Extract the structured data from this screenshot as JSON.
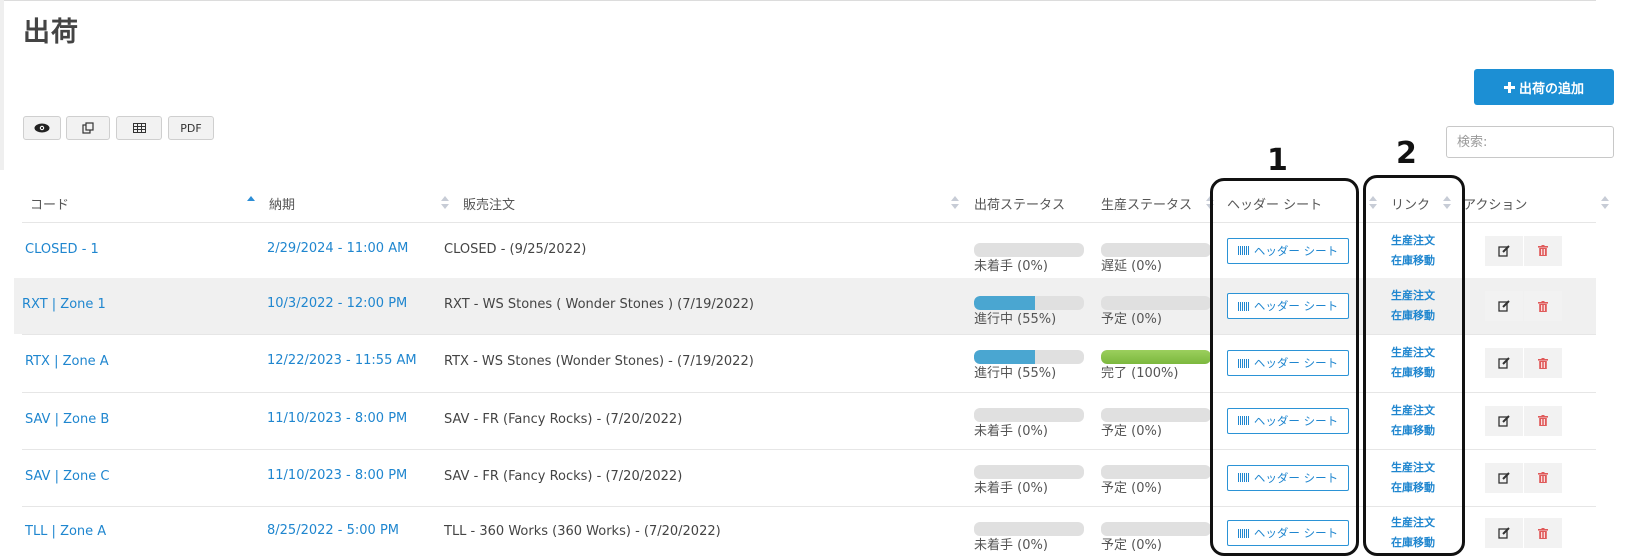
{
  "page": {
    "title": "出荷"
  },
  "toolbar": {
    "add_label": "出荷の追加",
    "add_icon": "plus-icon",
    "view_icon": "eye-icon",
    "copy_icon": "copy-icon",
    "grid_icon": "grid-icon",
    "pdf_label": "PDF",
    "search_placeholder": "検索:"
  },
  "table": {
    "columns": [
      "コード",
      "納期",
      "販売注文",
      "出荷ステータス",
      "生産ステータス",
      "ヘッダー シート",
      "リンク",
      "アクション"
    ],
    "sorted_column": "納期",
    "rows": [
      {
        "code": "CLOSED - 1",
        "due": "2/29/2024 - 11:00 AM",
        "order": "CLOSED - (9/25/2022)",
        "ship_status": "未着手 (0%)",
        "ship_progress": 0,
        "prod_status": "遅延 (0%)",
        "prod_progress": 0,
        "sheet_label": "ヘッダー シート",
        "link1": "生産注文",
        "link2": "在庫移動"
      },
      {
        "code": "RXT | Zone 1",
        "due": "10/3/2022 - 12:00 PM",
        "order": "RXT - WS Stones ( Wonder Stones ) (7/19/2022)",
        "ship_status": "進行中 (55%)",
        "ship_progress": 55,
        "prod_status": "予定 (0%)",
        "prod_progress": 0,
        "sheet_label": "ヘッダー シート",
        "link1": "生産注文",
        "link2": "在庫移動"
      },
      {
        "code": "RTX | Zone A",
        "due": "12/22/2023 - 11:55 AM",
        "order": "RTX - WS Stones (Wonder Stones) - (7/19/2022)",
        "ship_status": "進行中 (55%)",
        "ship_progress": 55,
        "prod_status": "完了 (100%)",
        "prod_progress": 100,
        "sheet_label": "ヘッダー シート",
        "link1": "生産注文",
        "link2": "在庫移動"
      },
      {
        "code": "SAV | Zone B",
        "due": "11/10/2023 - 8:00 PM",
        "order": "SAV - FR (Fancy Rocks) - (7/20/2022)",
        "ship_status": "未着手 (0%)",
        "ship_progress": 0,
        "prod_status": "予定 (0%)",
        "prod_progress": 0,
        "sheet_label": "ヘッダー シート",
        "link1": "生産注文",
        "link2": "在庫移動"
      },
      {
        "code": "SAV | Zone C",
        "due": "11/10/2023 - 8:00 PM",
        "order": "SAV - FR (Fancy Rocks) - (7/20/2022)",
        "ship_status": "未着手 (0%)",
        "ship_progress": 0,
        "prod_status": "予定 (0%)",
        "prod_progress": 0,
        "sheet_label": "ヘッダー シート",
        "link1": "生産注文",
        "link2": "在庫移動"
      },
      {
        "code": "TLL | Zone A",
        "due": "8/25/2022 - 5:00 PM",
        "order": "TLL - 360 Works (360 Works) - (7/20/2022)",
        "ship_status": "未着手 (0%)",
        "ship_progress": 0,
        "prod_status": "予定 (0%)",
        "prod_progress": 0,
        "sheet_label": "ヘッダー シート",
        "link1": "生産注文",
        "link2": "在庫移動"
      }
    ]
  },
  "annotations": [
    {
      "label": "1",
      "target": "ヘッダー シート"
    },
    {
      "label": "2",
      "target": "リンク"
    }
  ]
}
